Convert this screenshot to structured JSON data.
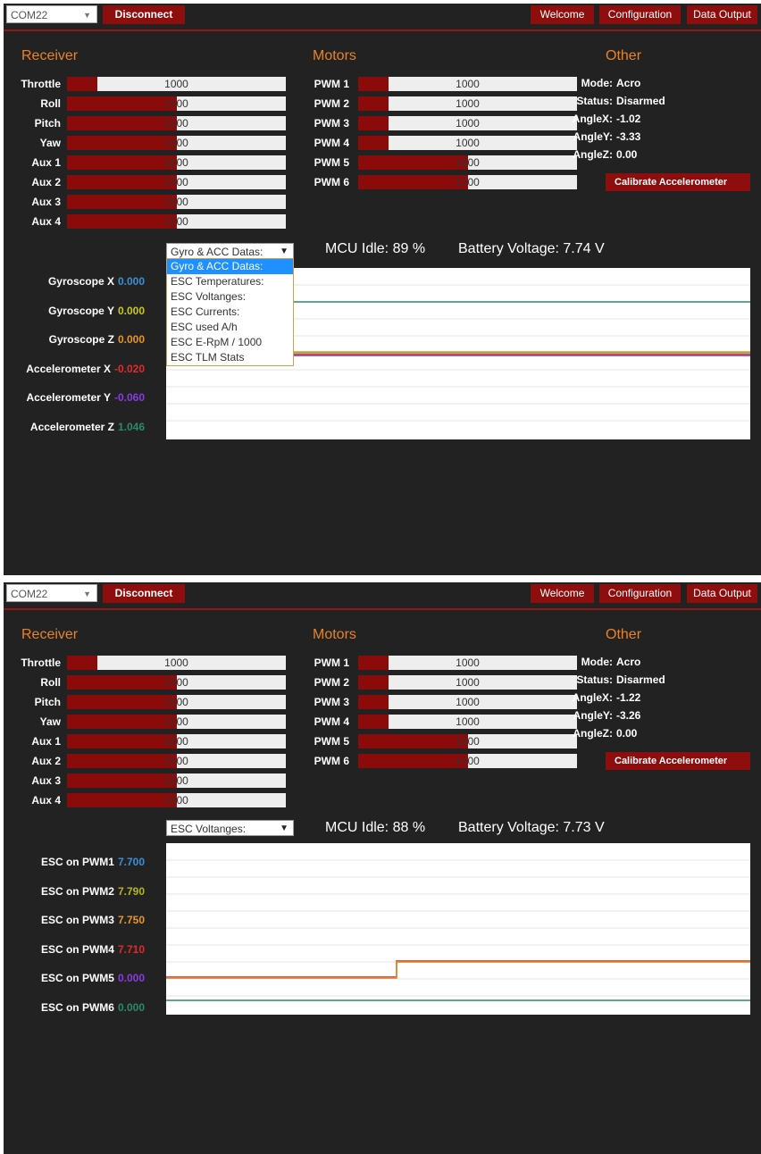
{
  "top": {
    "port": "COM22",
    "disconnect": "Disconnect",
    "tabs": [
      "Welcome",
      "Configuration",
      "Data Output"
    ]
  },
  "sections": {
    "receiver": "Receiver",
    "motors": "Motors",
    "other": "Other"
  },
  "calibrate": "Calibrate Accelerometer",
  "colors": {
    "accent": "#8b0a0a",
    "heading": "#e8832a"
  },
  "panels": [
    {
      "receiver": [
        {
          "label": "Throttle",
          "value": "1000",
          "fill": 0.14
        },
        {
          "label": "Roll",
          "value": "1500",
          "fill": 0.5
        },
        {
          "label": "Pitch",
          "value": "1500",
          "fill": 0.5
        },
        {
          "label": "Yaw",
          "value": "1500",
          "fill": 0.5
        },
        {
          "label": "Aux 1",
          "value": "1500",
          "fill": 0.5
        },
        {
          "label": "Aux 2",
          "value": "1500",
          "fill": 0.5
        },
        {
          "label": "Aux 3",
          "value": "1500",
          "fill": 0.5
        },
        {
          "label": "Aux 4",
          "value": "1500",
          "fill": 0.5
        }
      ],
      "motors": [
        {
          "label": "PWM 1",
          "value": "1000",
          "fill": 0.14
        },
        {
          "label": "PWM 2",
          "value": "1000",
          "fill": 0.14
        },
        {
          "label": "PWM 3",
          "value": "1000",
          "fill": 0.14
        },
        {
          "label": "PWM 4",
          "value": "1000",
          "fill": 0.14
        },
        {
          "label": "PWM 5",
          "value": "1500",
          "fill": 0.5
        },
        {
          "label": "PWM 6",
          "value": "1500",
          "fill": 0.5
        }
      ],
      "other": [
        {
          "key": "Mode:",
          "value": "Acro"
        },
        {
          "key": "Status:",
          "value": "Disarmed"
        },
        {
          "key": "AngleX:",
          "value": "-1.02"
        },
        {
          "key": "AngleY:",
          "value": "-3.33"
        },
        {
          "key": "AngleZ:",
          "value": "0.00"
        }
      ],
      "select": "Gyro & ACC Datas:",
      "mcu": "MCU Idle: 89 %",
      "battery": "Battery Voltage: 7.74 V",
      "dropdown": [
        "Gyro & ACC Datas:",
        "ESC Temperatures:",
        "ESC Voltanges:",
        "ESC Currents:",
        "ESC used A/h",
        "ESC E-RpM / 1000",
        "ESC TLM Stats"
      ],
      "series": [
        {
          "name": "Gyroscope X",
          "value": "0.000",
          "color": "#3b8fd9"
        },
        {
          "name": "Gyroscope Y",
          "value": "0.000",
          "color": "#c9c91a"
        },
        {
          "name": "Gyroscope Z",
          "value": "0.000",
          "color": "#e8952a"
        },
        {
          "name": "Accelerometer X",
          "value": "-0.020",
          "color": "#e02b2b"
        },
        {
          "name": "Accelerometer Y",
          "value": "-0.060",
          "color": "#8a3be0"
        },
        {
          "name": "Accelerometer Z",
          "value": "1.046",
          "color": "#2a8a6a"
        }
      ]
    },
    {
      "receiver": [
        {
          "label": "Throttle",
          "value": "1000",
          "fill": 0.14
        },
        {
          "label": "Roll",
          "value": "1500",
          "fill": 0.5
        },
        {
          "label": "Pitch",
          "value": "1500",
          "fill": 0.5
        },
        {
          "label": "Yaw",
          "value": "1500",
          "fill": 0.5
        },
        {
          "label": "Aux 1",
          "value": "1500",
          "fill": 0.5
        },
        {
          "label": "Aux 2",
          "value": "1500",
          "fill": 0.5
        },
        {
          "label": "Aux 3",
          "value": "1500",
          "fill": 0.5
        },
        {
          "label": "Aux 4",
          "value": "1500",
          "fill": 0.5
        }
      ],
      "motors": [
        {
          "label": "PWM 1",
          "value": "1000",
          "fill": 0.14
        },
        {
          "label": "PWM 2",
          "value": "1000",
          "fill": 0.14
        },
        {
          "label": "PWM 3",
          "value": "1000",
          "fill": 0.14
        },
        {
          "label": "PWM 4",
          "value": "1000",
          "fill": 0.14
        },
        {
          "label": "PWM 5",
          "value": "1500",
          "fill": 0.5
        },
        {
          "label": "PWM 6",
          "value": "1500",
          "fill": 0.5
        }
      ],
      "other": [
        {
          "key": "Mode:",
          "value": "Acro"
        },
        {
          "key": "Status:",
          "value": "Disarmed"
        },
        {
          "key": "AngleX:",
          "value": "-1.22"
        },
        {
          "key": "AngleY:",
          "value": "-3.26"
        },
        {
          "key": "AngleZ:",
          "value": "0.00"
        }
      ],
      "select": "ESC Voltanges:",
      "mcu": "MCU Idle: 88 %",
      "battery": "Battery Voltage: 7.73 V",
      "series": [
        {
          "name": "ESC on PWM1",
          "value": "7.700",
          "color": "#3b8fd9"
        },
        {
          "name": "ESC on PWM2",
          "value": "7.790",
          "color": "#b5b520"
        },
        {
          "name": "ESC on PWM3",
          "value": "7.750",
          "color": "#e8952a"
        },
        {
          "name": "ESC on PWM4",
          "value": "7.710",
          "color": "#e02b2b"
        },
        {
          "name": "ESC on PWM5",
          "value": "0.000",
          "color": "#8a3be0"
        },
        {
          "name": "ESC on PWM6",
          "value": "0.000",
          "color": "#2a8a6a"
        }
      ]
    }
  ]
}
